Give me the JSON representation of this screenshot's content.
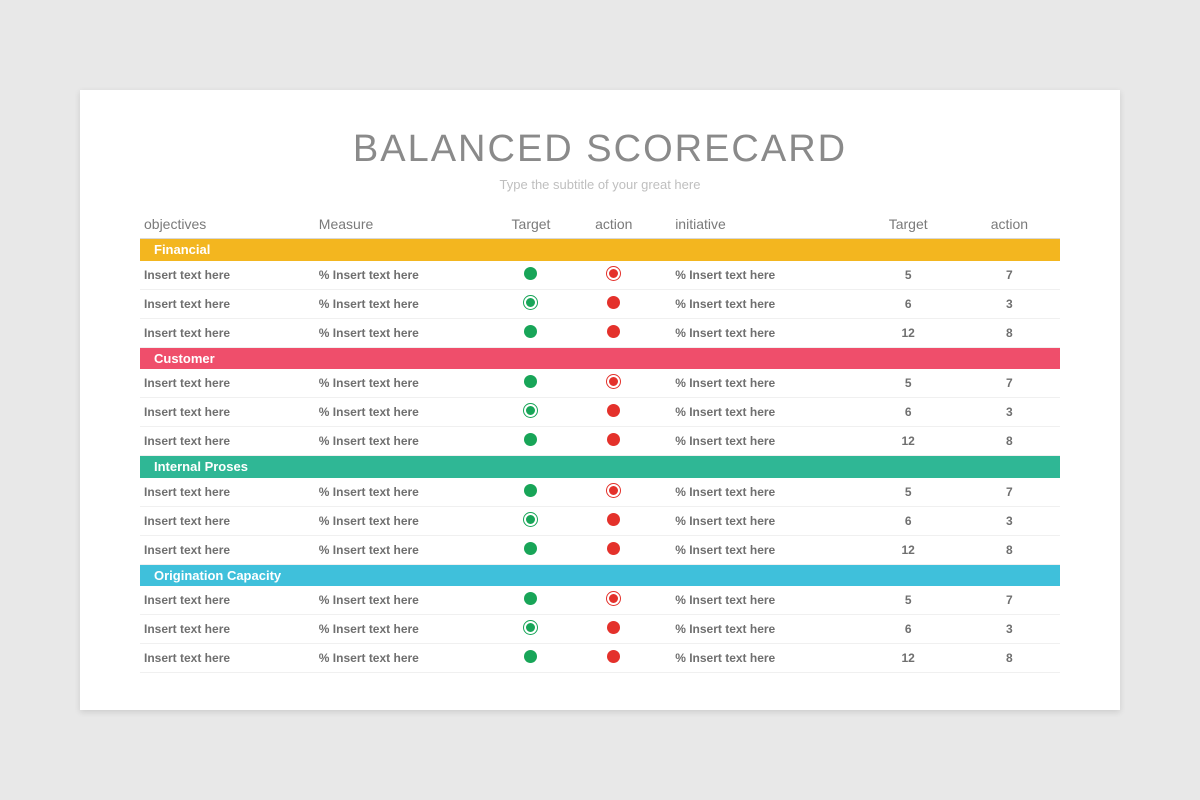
{
  "title": "BALANCED SCORECARD",
  "subtitle": "Type the subtitle of your great here",
  "headers": {
    "objectives": "objectives",
    "measure": "Measure",
    "target1": "Target",
    "action1": "action",
    "initiative": "initiative",
    "target2": "Target",
    "action2": "action"
  },
  "sections": [
    {
      "label": "Financial",
      "barClass": "bar-yellow"
    },
    {
      "label": "Customer",
      "barClass": "bar-pink"
    },
    {
      "label": "Internal Proses",
      "barClass": "bar-teal"
    },
    {
      "label": "Origination Capacity",
      "barClass": "bar-cyan"
    }
  ],
  "row_template": [
    {
      "obj": "Insert text here",
      "meas": "% Insert text here",
      "tIcon": "dot-green",
      "aIcon": "dot-ring-red",
      "init": "% Insert text here",
      "t2": "5",
      "a2": "7"
    },
    {
      "obj": "Insert text here",
      "meas": "% Insert text here",
      "tIcon": "dot-ring-green",
      "aIcon": "dot-red",
      "init": "% Insert text here",
      "t2": "6",
      "a2": "3"
    },
    {
      "obj": "Insert text here",
      "meas": "% Insert text here",
      "tIcon": "dot-green",
      "aIcon": "dot-red",
      "init": "% Insert text here",
      "t2": "12",
      "a2": "8"
    }
  ]
}
